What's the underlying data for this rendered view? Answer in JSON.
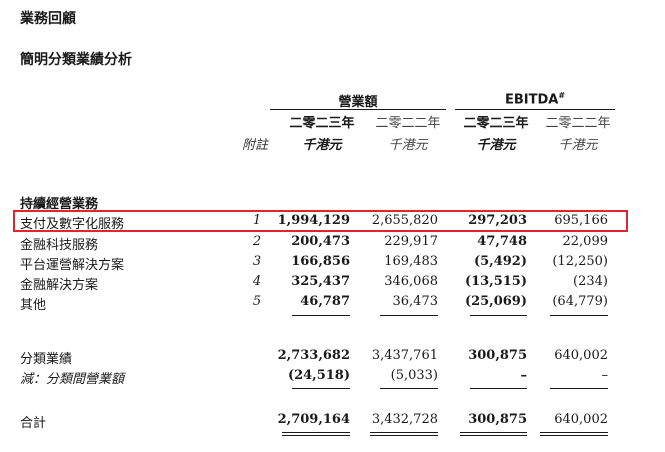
{
  "heading": "業務回顧",
  "subheading": "簡明分類業績分析",
  "groups": {
    "revenue": "營業額",
    "ebitda": "EBITDA",
    "ebitda_mark": "#"
  },
  "years": {
    "current": "二零二三年",
    "prior": "二零二二年"
  },
  "unit": "千港元",
  "note_header": "附註",
  "section_label": "持續經營業務",
  "rows": [
    {
      "label": "支付及數字化服務",
      "note": "1",
      "rev23": "1,994,129",
      "rev22": "2,655,820",
      "eb23": "297,203",
      "eb22": "695,166"
    },
    {
      "label": "金融科技服務",
      "note": "2",
      "rev23": "200,473",
      "rev22": "229,917",
      "eb23": "47,748",
      "eb22": "22,099"
    },
    {
      "label": "平台運營解決方案",
      "note": "3",
      "rev23": "166,856",
      "rev22": "169,483",
      "eb23": "(5,492)",
      "eb22": "(12,250)"
    },
    {
      "label": "金融解決方案",
      "note": "4",
      "rev23": "325,437",
      "rev22": "346,068",
      "eb23": "(13,515)",
      "eb22": "(234)"
    },
    {
      "label": "其他",
      "note": "5",
      "rev23": "46,787",
      "rev22": "36,473",
      "eb23": "(25,069)",
      "eb22": "(64,779)"
    }
  ],
  "segment_results": {
    "label": "分類業績",
    "rev23": "2,733,682",
    "rev22": "3,437,761",
    "eb23": "300,875",
    "eb22": "640,002"
  },
  "less_row": {
    "label": "減：分類間營業額",
    "rev23": "(24,518)",
    "rev22": "(5,033)",
    "eb23": "–",
    "eb22": "–"
  },
  "total": {
    "label": "合計",
    "rev23": "2,709,164",
    "rev22": "3,432,728",
    "eb23": "300,875",
    "eb22": "640,002"
  },
  "highlight_color": "#e0262d"
}
